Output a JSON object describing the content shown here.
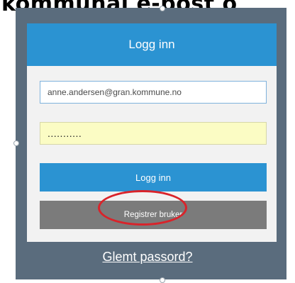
{
  "heading": {
    "cropped_text": "kommunal e-post o"
  },
  "login_panel": {
    "title": "Logg inn",
    "email_value": "anne.andersen@gran.kommune.no",
    "password_mask": "...........",
    "login_button_label": "Logg inn",
    "register_button_label": "Registrer bruker"
  },
  "footer": {
    "forgot_password_link": "Glemt passord?"
  },
  "colors": {
    "accent_blue": "#2b93d2",
    "frame_gray": "#5a6c7d",
    "register_gray": "#7b7b7b",
    "password_bg": "#fbfcc4",
    "highlight_red": "#d9232a"
  }
}
